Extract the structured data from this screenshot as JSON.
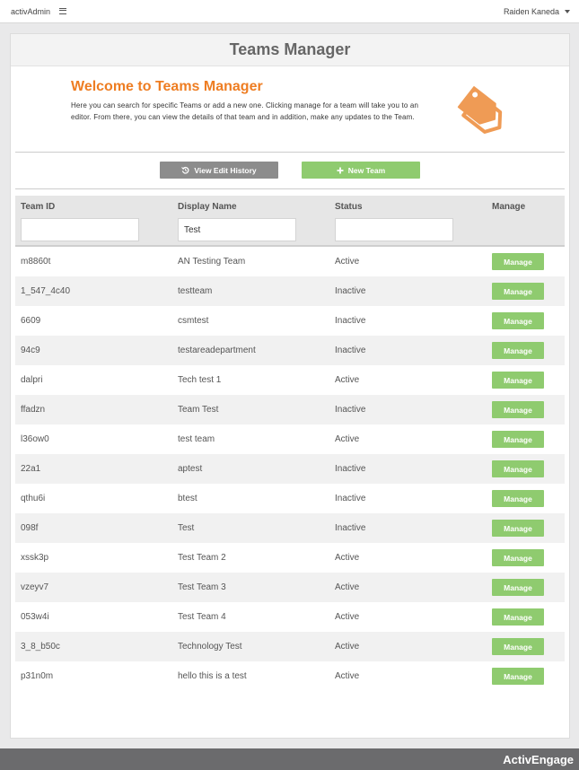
{
  "topbar": {
    "app_name": "activAdmin",
    "user_name": "Raiden Kaneda"
  },
  "page": {
    "title": "Teams Manager"
  },
  "welcome": {
    "heading": "Welcome to Teams Manager",
    "text": "Here you can search for specific Teams or add a new one. Clicking manage for a team will take you to an editor. From there, you can view the details of that team and in addition, make any updates to the Team."
  },
  "actions": {
    "history_label": "View Edit History",
    "new_label": "New Team"
  },
  "table": {
    "headers": {
      "team_id": "Team ID",
      "display_name": "Display Name",
      "status": "Status",
      "manage": "Manage"
    },
    "filters": {
      "team_id": "",
      "display_name": "Test",
      "status": ""
    },
    "manage_label": "Manage",
    "rows": [
      {
        "id": "m8860t",
        "name": "AN Testing Team",
        "status": "Active"
      },
      {
        "id": "1_547_4c40",
        "name": "testteam",
        "status": "Inactive"
      },
      {
        "id": "6609",
        "name": "csmtest",
        "status": "Inactive"
      },
      {
        "id": "94c9",
        "name": "testareadepartment",
        "status": "Inactive"
      },
      {
        "id": "dalpri",
        "name": "Tech test 1",
        "status": "Active"
      },
      {
        "id": "ffadzn",
        "name": "Team Test",
        "status": "Inactive"
      },
      {
        "id": "l36ow0",
        "name": "test team",
        "status": "Active"
      },
      {
        "id": "22a1",
        "name": "aptest",
        "status": "Inactive"
      },
      {
        "id": "qthu6i",
        "name": "btest",
        "status": "Inactive"
      },
      {
        "id": "098f",
        "name": "Test",
        "status": "Inactive"
      },
      {
        "id": "xssk3p",
        "name": "Test Team 2",
        "status": "Active"
      },
      {
        "id": "vzeyv7",
        "name": "Test Team 3",
        "status": "Active"
      },
      {
        "id": "053w4i",
        "name": "Test Team 4",
        "status": "Active"
      },
      {
        "id": "3_8_b50c",
        "name": "Technology Test",
        "status": "Active"
      },
      {
        "id": "p31n0m",
        "name": "hello this is a test",
        "status": "Active"
      }
    ]
  },
  "footer": {
    "brand": "ActivEngage"
  },
  "colors": {
    "accent_orange": "#ee7d22",
    "button_green": "#8fcb6f",
    "button_gray": "#8c8c8c",
    "footer_bg": "#6b6b6d"
  },
  "icons": [
    "menu-icon",
    "chevron-down-icon",
    "price-tag-icon",
    "history-icon",
    "plus-icon"
  ]
}
